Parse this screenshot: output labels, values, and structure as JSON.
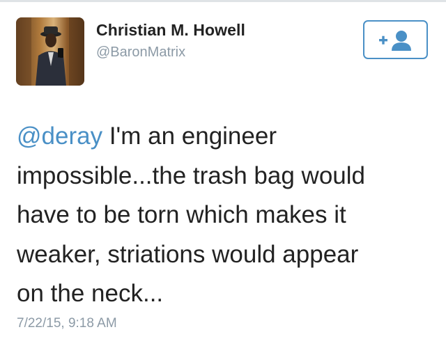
{
  "tweet": {
    "author": {
      "display_name": "Christian M. Howell",
      "handle": "@BaronMatrix",
      "avatar_alt": "profile-photo"
    },
    "follow_button": {
      "icon": "add-user-icon",
      "accent_color": "#4a90c6"
    },
    "text": {
      "mention": "@deray",
      "body": " I'm an engineer\nimpossible...the trash bag would\nhave to be torn which makes it\nweaker, striations would appear\non the neck..."
    },
    "timestamp": "7/22/15, 9:18 AM"
  },
  "colors": {
    "link": "#4a90c6",
    "secondary_text": "#8c9aa6",
    "primary_text": "#222222"
  }
}
